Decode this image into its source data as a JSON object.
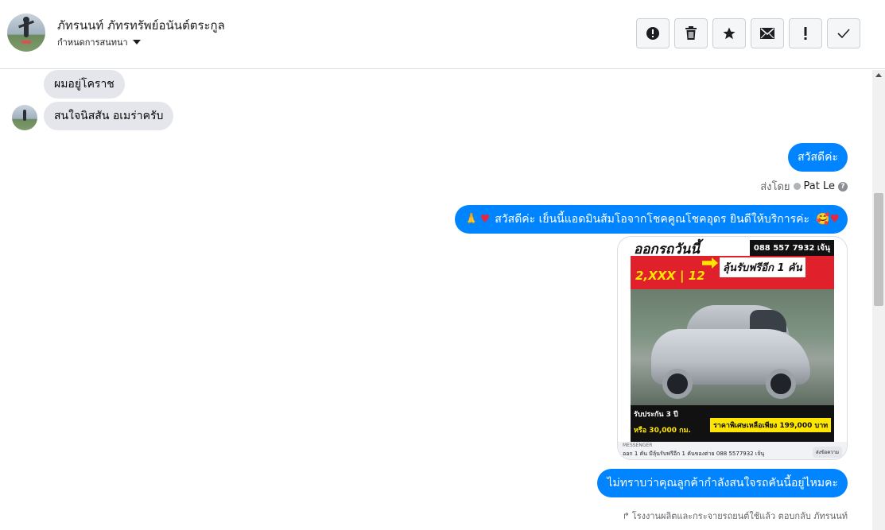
{
  "header": {
    "contact_name": "ภัทรนนท์ ภัทรทรัพย์อนันต์ตระกูล",
    "assign_label": "กำหนดการสนทนา",
    "toolbar": [
      {
        "name": "spam-button",
        "icon": "exclamation-circle-icon",
        "glyph": "!"
      },
      {
        "name": "delete-button",
        "icon": "trash-icon",
        "glyph": ""
      },
      {
        "name": "star-button",
        "icon": "star-icon",
        "glyph": "★"
      },
      {
        "name": "email-button",
        "icon": "envelope-icon",
        "glyph": "✉"
      },
      {
        "name": "important-button",
        "icon": "exclamation-icon",
        "glyph": "!"
      },
      {
        "name": "done-button",
        "icon": "check-icon",
        "glyph": "✓"
      }
    ]
  },
  "messages": {
    "in_1": "ผมอยู่โคราช",
    "in_2": "สนใจนิสสัน อเมร่าครับ",
    "out_1": "สวัสดีค่ะ",
    "sent_by_prefix": "ส่งโดย",
    "sent_by_agent": "Pat Le",
    "out_2": "สวัสดีค่ะ เย็นนี้แอดมินส้มโอจากโชคคูณโชคอุดร ยินดีให้บริการค่ะ",
    "out_3": "ไม่ทราบว่าคุณลูกค้ากำลังสนใจรถคันนี้อยู่ไหมคะ",
    "reply_note": "โรงงานผลิตและกระจายรถยนต์ใช้แล้ว ตอบกลับ ภัทรนนท์"
  },
  "card": {
    "poster_title": "ออกรถวันนี้",
    "poster_phone": "088 557 7932 เจ้นุ",
    "poster_free": "ลุ้นรับฟรีอีก 1 คัน",
    "poster_price": "2,XXX | 12",
    "poster_bottom_1": "รับประกัน 3 ปี",
    "poster_bottom_2": "ราคาพิเศษเหลือเพียง 199,000 บาท",
    "poster_bottom_3": "หรือ 30,000 กม.",
    "source_label": "MESSENGER",
    "caption": "ออก 1 คัน มีลุ้นรับฟรีอีก 1 คันของต่าย 088 5577932 เจ้นุ",
    "send_button": "ส่งข้อความ"
  },
  "colors": {
    "outgoing": "#0084ff",
    "incoming": "#e4e6eb"
  }
}
